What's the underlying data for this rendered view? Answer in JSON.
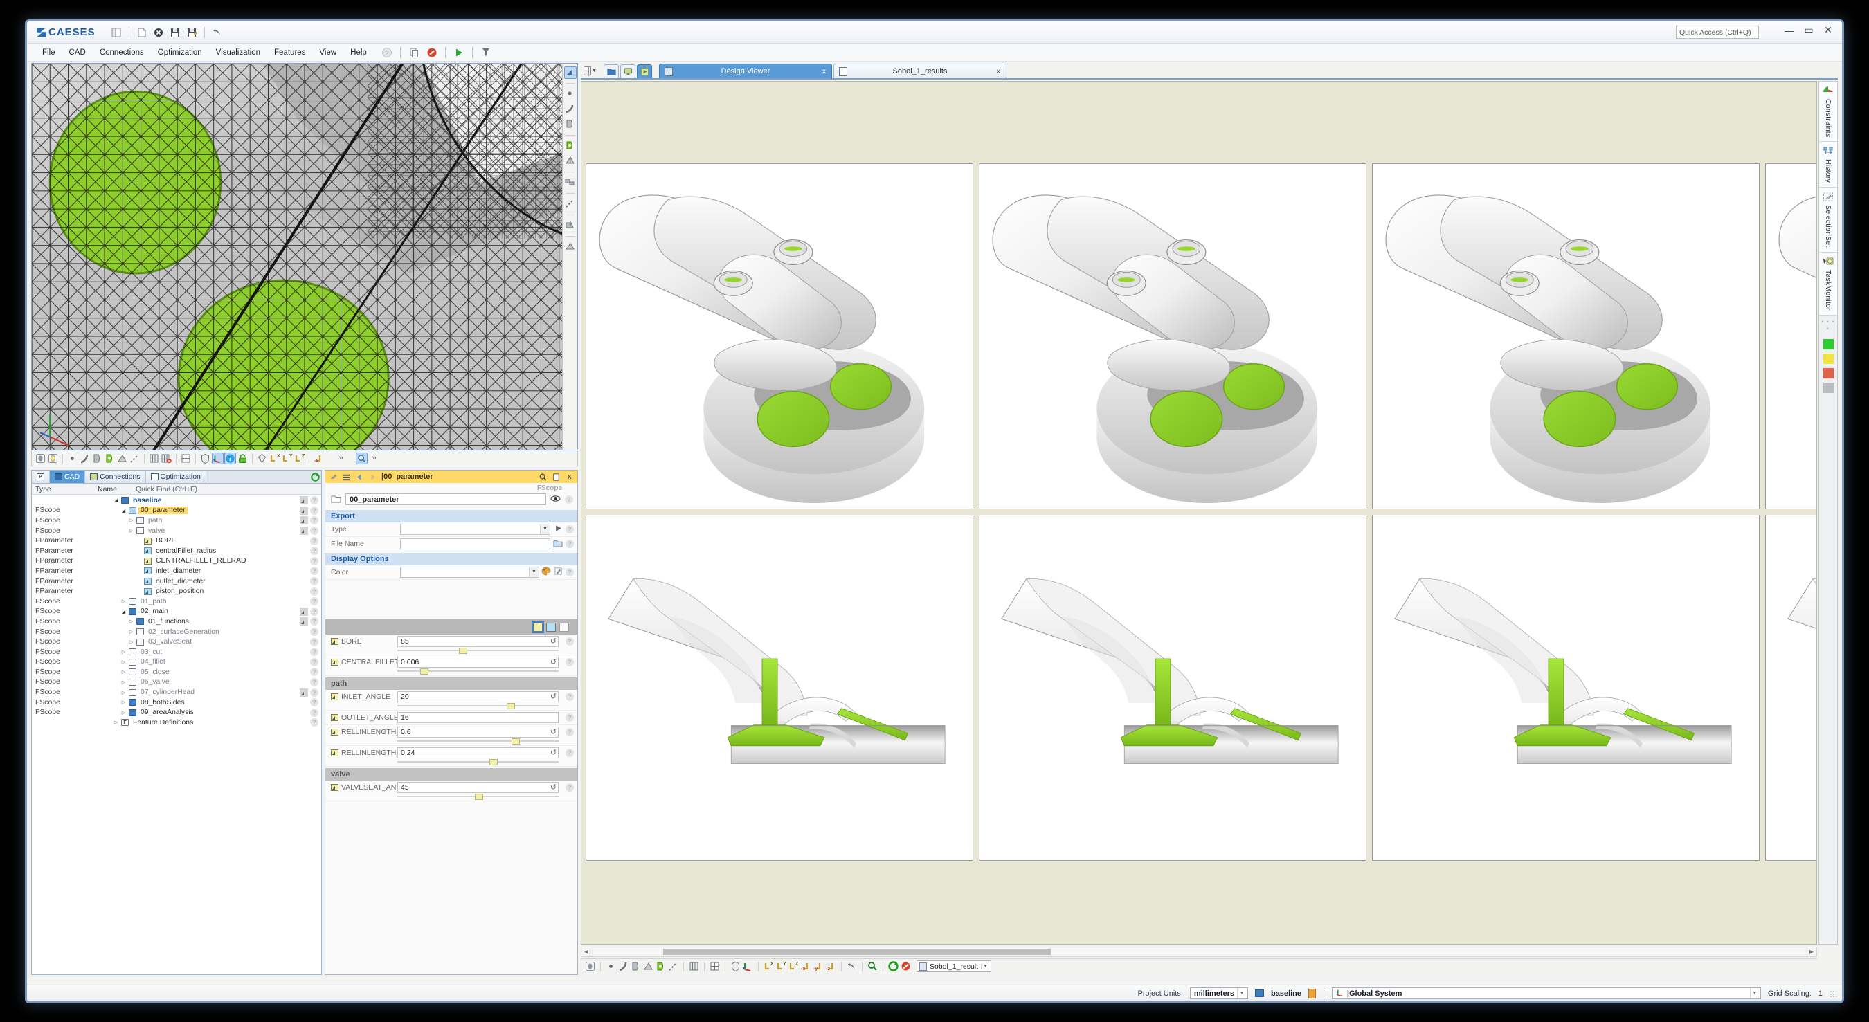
{
  "app": {
    "brand": "CAESES",
    "quick_access_placeholder": "Quick Access (Ctrl+Q)"
  },
  "window_buttons": {
    "minimize": "—",
    "restore": "▭",
    "close": "✕"
  },
  "menu": [
    {
      "label": "File",
      "accel": "F"
    },
    {
      "label": "CAD",
      "accel": "A"
    },
    {
      "label": "Connections",
      "accel": "n"
    },
    {
      "label": "Optimization",
      "accel": "O"
    },
    {
      "label": "Visualization",
      "accel": "V"
    },
    {
      "label": "Features",
      "accel": "a"
    },
    {
      "label": "View",
      "accel": "i"
    },
    {
      "label": "Help",
      "accel": "H"
    }
  ],
  "titlebar_icons": [
    "panel-layout-icon",
    "new-document-icon",
    "close-document-icon",
    "save-icon",
    "save-as-icon",
    "undo-icon"
  ],
  "menubar_icons": [
    "help-icon",
    "copy-icon",
    "stop-icon",
    "run-icon",
    "measure-icon"
  ],
  "left_viewport": {
    "name": "3d-mesh-viewport",
    "right_tool_icons": [
      "select-arrow-icon",
      "point-icon",
      "curve-icon",
      "surface-icon",
      "solid-icon",
      "mesh-icon",
      "feature-icon",
      "polyline-icon",
      "shell-icon",
      "plane-icon"
    ],
    "bottom_tool_icons": [
      "show-hide-icon",
      "highlight-icon",
      "point-toggle-icon",
      "curve-toggle-icon",
      "surface-toggle-icon",
      "mesh-toggle-icon",
      "plane-toggle-icon",
      "polyline-toggle-icon",
      "sections-icon",
      "no-sections-icon",
      "grid-icon",
      "shield-icon",
      "axes-icon",
      "info-icon",
      "lock-icon",
      "shade-icon",
      "view-x-icon",
      "view-y-icon",
      "view-z-icon",
      "view-minus-x-icon",
      "overflow-icon",
      "zoom-icon",
      "overflow2-icon"
    ]
  },
  "tree": {
    "tabs": [
      {
        "label": "",
        "icon": "properties-icon",
        "selected": false
      },
      {
        "label": "CAD",
        "icon": "cad-icon",
        "selected": true
      },
      {
        "label": "Connections",
        "icon": "connections-icon",
        "selected": false
      },
      {
        "label": "Optimization",
        "icon": "optimization-icon",
        "selected": false
      }
    ],
    "refresh_icon": "refresh-icon",
    "columns": {
      "type": "Type",
      "name": "Name",
      "find": "Quick Find (Ctrl+F)"
    },
    "rows": [
      {
        "type": "",
        "indent": 2,
        "arrow": "open",
        "icon": "folder-blue",
        "label": "baseline",
        "bold": true,
        "selected": false,
        "end": true
      },
      {
        "type": "FScope",
        "indent": 3,
        "arrow": "open",
        "icon": "folder-lblue",
        "label": "00_parameter",
        "bold": false,
        "selected": true,
        "end": true
      },
      {
        "type": "FScope",
        "indent": 4,
        "arrow": "closed",
        "icon": "folder-white",
        "label": "path",
        "bold": false,
        "selected": false,
        "end": true
      },
      {
        "type": "FScope",
        "indent": 4,
        "arrow": "closed",
        "icon": "folder-white",
        "label": "valve",
        "bold": false,
        "selected": false,
        "end": true
      },
      {
        "type": "FParameter",
        "indent": 5,
        "arrow": "",
        "icon": "param-yellow",
        "label": "BORE",
        "bold": false,
        "selected": false,
        "end": false
      },
      {
        "type": "FParameter",
        "indent": 5,
        "arrow": "",
        "icon": "param-cyan",
        "label": "centralFillet_radius",
        "bold": false,
        "selected": false,
        "end": false
      },
      {
        "type": "FParameter",
        "indent": 5,
        "arrow": "",
        "icon": "param-yellow",
        "label": "CENTRALFILLET_RELRAD",
        "bold": false,
        "selected": false,
        "end": false
      },
      {
        "type": "FParameter",
        "indent": 5,
        "arrow": "",
        "icon": "param-cyan",
        "label": "inlet_diameter",
        "bold": false,
        "selected": false,
        "end": false
      },
      {
        "type": "FParameter",
        "indent": 5,
        "arrow": "",
        "icon": "param-cyan",
        "label": "outlet_diameter",
        "bold": false,
        "selected": false,
        "end": false
      },
      {
        "type": "FParameter",
        "indent": 5,
        "arrow": "",
        "icon": "param-cyan",
        "label": "piston_position",
        "bold": false,
        "selected": false,
        "end": false
      },
      {
        "type": "FScope",
        "indent": 3,
        "arrow": "closed",
        "icon": "folder-white",
        "label": "01_path",
        "bold": false,
        "selected": false,
        "end": false
      },
      {
        "type": "FScope",
        "indent": 3,
        "arrow": "open",
        "icon": "folder-blue",
        "label": "02_main",
        "bold": false,
        "selected": false,
        "end": true
      },
      {
        "type": "FScope",
        "indent": 4,
        "arrow": "closed",
        "icon": "folder-blue",
        "label": "01_functions",
        "bold": false,
        "selected": false,
        "end": true
      },
      {
        "type": "FScope",
        "indent": 4,
        "arrow": "closed",
        "icon": "folder-white",
        "label": "02_surfaceGeneration",
        "bold": false,
        "selected": false,
        "end": false
      },
      {
        "type": "FScope",
        "indent": 4,
        "arrow": "closed",
        "icon": "folder-white",
        "label": "03_valveSeat",
        "bold": false,
        "selected": false,
        "end": false
      },
      {
        "type": "FScope",
        "indent": 3,
        "arrow": "closed",
        "icon": "folder-white",
        "label": "03_cut",
        "bold": false,
        "selected": false,
        "end": false
      },
      {
        "type": "FScope",
        "indent": 3,
        "arrow": "closed",
        "icon": "folder-white",
        "label": "04_fillet",
        "bold": false,
        "selected": false,
        "end": false
      },
      {
        "type": "FScope",
        "indent": 3,
        "arrow": "closed",
        "icon": "folder-white",
        "label": "05_close",
        "bold": false,
        "selected": false,
        "end": false
      },
      {
        "type": "FScope",
        "indent": 3,
        "arrow": "closed",
        "icon": "folder-white",
        "label": "06_valve",
        "bold": false,
        "selected": false,
        "end": false
      },
      {
        "type": "FScope",
        "indent": 3,
        "arrow": "closed",
        "icon": "folder-white",
        "label": "07_cylinderHead",
        "bold": false,
        "selected": false,
        "end": true
      },
      {
        "type": "FScope",
        "indent": 3,
        "arrow": "closed",
        "icon": "folder-blue",
        "label": "08_bothSides",
        "bold": false,
        "selected": false,
        "end": false
      },
      {
        "type": "FScope",
        "indent": 3,
        "arrow": "closed",
        "icon": "folder-blue",
        "label": "09_areaAnalysis",
        "bold": false,
        "selected": false,
        "end": false
      },
      {
        "type": "",
        "indent": 2,
        "arrow": "closed",
        "icon": "feature-def",
        "label": "Feature Definitions",
        "bold": false,
        "selected": false,
        "end": false
      }
    ]
  },
  "param_panel": {
    "title": "|00_parameter",
    "title_icons": [
      "pin-icon",
      "list-icon",
      "back-arrow-icon",
      "forward-arrow-icon"
    ],
    "title_right_icons": [
      "search-icon",
      "duplicate-icon",
      "close-icon"
    ],
    "scope_type": "FScope",
    "name_value": "00_parameter",
    "visibility_icon": "eye-icon",
    "sections": {
      "export": {
        "label": "Export",
        "fields": [
          {
            "label": "Type",
            "value": "",
            "kind": "combo",
            "trailing": "run-icon"
          },
          {
            "label": "File Name",
            "value": "",
            "kind": "text",
            "trailing": "folder-icon"
          }
        ]
      },
      "display_options": {
        "label": "Display Options",
        "fields": [
          {
            "label": "Color",
            "value": "",
            "kind": "combo",
            "trailing": "palette-icon"
          }
        ]
      }
    },
    "toolbar_icons": [
      "param-yellow-icon",
      "param-cyan-icon",
      "edit-icon"
    ],
    "parameters": [
      {
        "label": "BORE",
        "value": "85",
        "slider": 38,
        "has_slider": true,
        "icon": "param-yellow-icon"
      },
      {
        "label": "CENTRALFILLET_RELRAD",
        "value": "0.006",
        "slider": 14,
        "has_slider": true,
        "icon": "param-yellow-icon"
      }
    ],
    "group_path": {
      "label": "path",
      "parameters": [
        {
          "label": "INLET_ANGLE",
          "value": "20",
          "slider": 68,
          "has_slider": true,
          "icon": "param-yellow-icon"
        },
        {
          "label": "OUTLET_ANGLE",
          "value": "16",
          "slider": 0,
          "has_slider": false,
          "icon": "param-yellow-icon"
        },
        {
          "label": "RELLINLENGTH_YPLANE",
          "value": "0.6",
          "slider": 71,
          "has_slider": true,
          "icon": "param-yellow-icon"
        },
        {
          "label": "RELLINLENGTH_ZPLANE",
          "value": "0.24",
          "slider": 57,
          "has_slider": true,
          "icon": "param-yellow-icon"
        }
      ]
    },
    "group_valve": {
      "label": "valve",
      "parameters": [
        {
          "label": "VALVESEAT_ANGLE",
          "value": "45",
          "slider": 48,
          "has_slider": true,
          "icon": "param-yellow-icon"
        }
      ]
    }
  },
  "right_panel": {
    "layout_icon": "split-layout-icon",
    "mode_buttons": [
      {
        "icon": "cad-mode-icon",
        "on": false
      },
      {
        "icon": "connections-mode-icon",
        "on": false
      },
      {
        "icon": "optimization-mode-icon",
        "on": true
      }
    ],
    "tabs": [
      {
        "label": "Design Viewer",
        "selected": true,
        "close": "x",
        "icon": "design-viewer-icon"
      },
      {
        "label": "Sobol_1_results",
        "selected": false,
        "close": "x",
        "icon": "results-icon"
      }
    ],
    "design_viewer": {
      "name": "design-viewer-canvas",
      "background_color": "#e8e6d4",
      "thumbnails": [
        {
          "row": 0,
          "col": 0,
          "view": "isometric-port",
          "name": "design-thumbnail"
        },
        {
          "row": 0,
          "col": 1,
          "view": "isometric-port",
          "name": "design-thumbnail"
        },
        {
          "row": 0,
          "col": 2,
          "view": "isometric-port",
          "name": "design-thumbnail"
        },
        {
          "row": 0,
          "col": 3,
          "view": "isometric-port",
          "name": "design-thumbnail"
        },
        {
          "row": 1,
          "col": 0,
          "view": "section-cut",
          "name": "design-thumbnail"
        },
        {
          "row": 1,
          "col": 1,
          "view": "section-cut",
          "name": "design-thumbnail"
        },
        {
          "row": 1,
          "col": 2,
          "view": "section-cut",
          "name": "design-thumbnail"
        },
        {
          "row": 1,
          "col": 3,
          "view": "section-cut",
          "name": "design-thumbnail"
        }
      ]
    },
    "bottom_toolbar_icons": [
      "show-hide-icon",
      "point-icon",
      "curve-icon",
      "surface-icon",
      "mesh-icon",
      "solid-green-icon",
      "polyline-icon",
      "sections-icon",
      "grid-icon",
      "shield-icon",
      "axes-icon",
      "view-x-icon",
      "view-y-icon",
      "view-z-icon",
      "view-minus-x-icon",
      "view-minus-y-icon",
      "view-minus-z-icon",
      "undo-icon",
      "zoom-icon",
      "refresh-icon",
      "stop-icon"
    ],
    "result_selector": "Sobol_1_result",
    "rail_tabs": [
      {
        "label": "Constraints",
        "icon": "constraints-icon"
      },
      {
        "label": "History",
        "icon": "history-icon"
      },
      {
        "label": "SelectionSet",
        "icon": "selectionset-icon"
      },
      {
        "label": "TaskMonitor",
        "icon": "taskmonitor-icon"
      }
    ],
    "rail_swatches": [
      "#2fcc2f",
      "#f0e442",
      "#e0614a",
      "#b9bcc0"
    ]
  },
  "statusbar": {
    "project_units_label": "Project Units:",
    "project_units_value": "millimeters",
    "model_name": "baseline",
    "coord_system": "|Global System",
    "grid_scaling_label": "Grid Scaling:",
    "grid_scaling_value": "1",
    "divider": "|"
  },
  "colors": {
    "brand_blue": "#1f5fa8",
    "selection_yellow": "#ffd966",
    "tab_blue": "#5b9bd5",
    "part_green": "#8dce2a",
    "viewer_bg": "#e8e6d4"
  }
}
